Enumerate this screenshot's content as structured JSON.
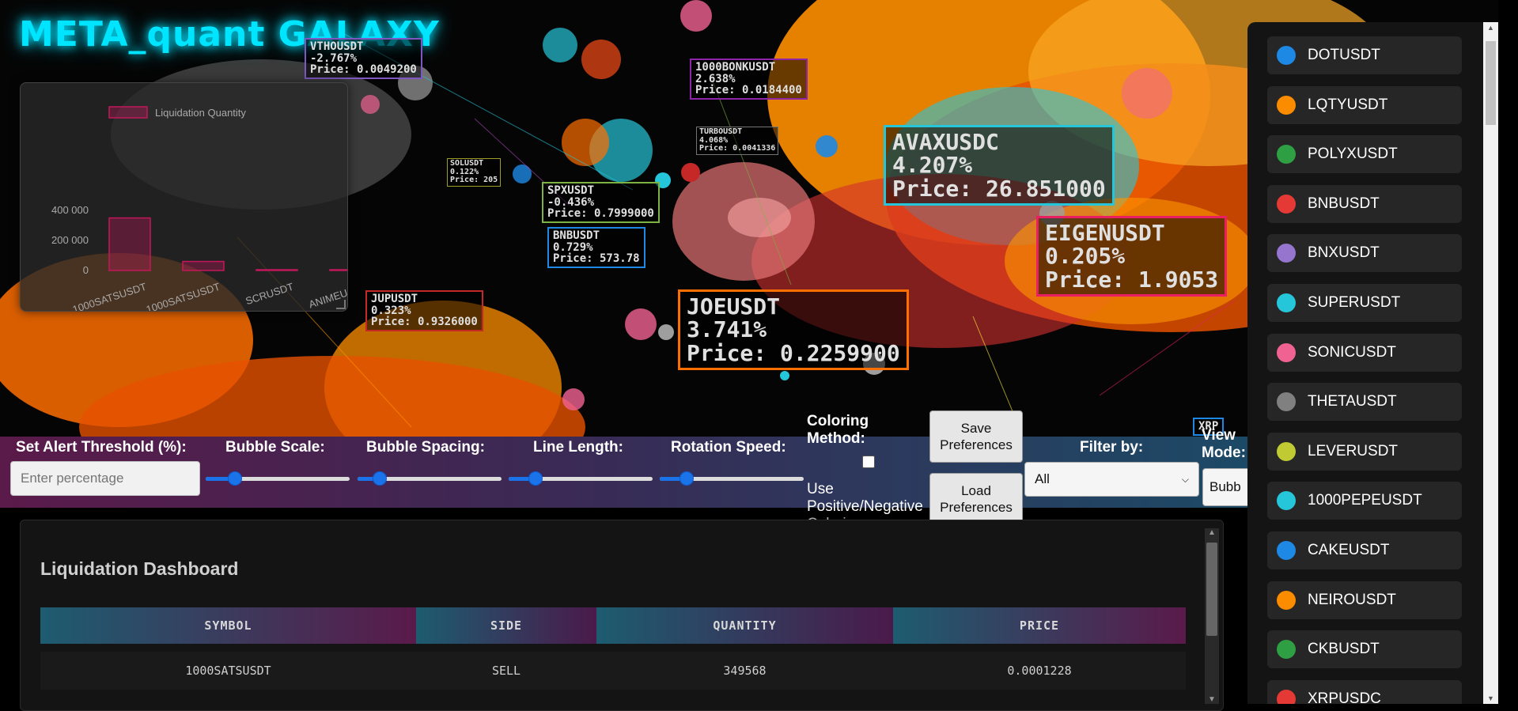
{
  "app": {
    "title": "META_quant GALAXY"
  },
  "colors": {
    "accent": "#00e5ff",
    "slider": "#1a73e8",
    "bar": "#c2185b"
  },
  "bubble_labels": [
    {
      "symbol": "AVAXUSDC",
      "pct": "4.207%",
      "price": "Price: 26.851000",
      "color": "#26c6da",
      "size": "big"
    },
    {
      "symbol": "EIGENUSDT",
      "pct": "0.205%",
      "price": "Price: 1.9053",
      "color": "#e91e63",
      "size": "big"
    },
    {
      "symbol": "JOEUSDT",
      "pct": "3.741%",
      "price": "Price: 0.2259900",
      "color": "#ff6f00",
      "size": "big"
    },
    {
      "symbol": "JUPUSDT",
      "pct": "0.323%",
      "price": "Price: 0.9326000",
      "color": "#c62828",
      "size": "mid"
    },
    {
      "symbol": "SPXUSDT",
      "pct": "-0.436%",
      "price": "Price: 0.7999000",
      "color": "#7cb342",
      "size": "mid"
    },
    {
      "symbol": "BNBUSDT",
      "pct": "0.729%",
      "price": "Price: 573.78",
      "color": "#1e88e5",
      "size": "mid"
    },
    {
      "symbol": "VTHOUSDT",
      "pct": "-2.767%",
      "price": "Price: 0.0049200",
      "color": "#7e57c2",
      "size": "mid"
    },
    {
      "symbol": "1000BONKUSDT",
      "pct": "2.638%",
      "price": "Price: 0.0184400",
      "color": "#8e24aa",
      "size": "mid"
    },
    {
      "symbol": "TURBOUSDT",
      "pct": "4.068%",
      "price": "Price: 0.0041336",
      "color": "#757575",
      "size": "small"
    },
    {
      "symbol": "SOLUSDT",
      "pct": "0.122%",
      "price": "Price: 205",
      "color": "#9e9d24",
      "size": "small"
    },
    {
      "symbol": "XRP",
      "pct": "",
      "price": "",
      "color": "#1e88e5",
      "size": "mid"
    }
  ],
  "mini_chart": {
    "chart_data": {
      "type": "bar",
      "categories": [
        "1000SATSUSDT",
        "1000SATSUSDT",
        "SCRUSDT",
        "ANIMEUSDT"
      ],
      "series": [
        {
          "name": "Liquidation Quantity",
          "values": [
            349568,
            60000,
            1500,
            1500
          ]
        }
      ],
      "ylim": [
        0,
        400000
      ],
      "yticks": [
        "400 000",
        "200 000",
        "0"
      ],
      "legend": "top"
    }
  },
  "controls": {
    "alert_label": "Set Alert Threshold (%):",
    "alert_placeholder": "Enter percentage",
    "bubble_scale_label": "Bubble Scale:",
    "bubble_scale_value": 0.2,
    "bubble_spacing_label": "Bubble Spacing:",
    "bubble_spacing_value": 0.15,
    "line_length_label": "Line Length:",
    "line_length_value": 0.18,
    "rotation_speed_label": "Rotation Speed:",
    "rotation_speed_value": 0.18,
    "coloring_label_1": "Coloring",
    "coloring_label_2": "Method:",
    "coloring_option_1": "Use",
    "coloring_option_2": "Positive/Negative",
    "coloring_option_3": "Coloring",
    "save_label_1": "Save",
    "save_label_2": "Preferences",
    "load_label_1": "Load",
    "load_label_2": "Preferences",
    "filter_label": "Filter by:",
    "filter_value": "All",
    "view_label_1": "View",
    "view_label_2": "Mode:",
    "view_value": "Bubb"
  },
  "dashboard": {
    "title": "Liquidation Dashboard",
    "columns": [
      "SYMBOL",
      "SIDE",
      "QUANTITY",
      "PRICE"
    ],
    "rows": [
      {
        "symbol": "1000SATSUSDT",
        "side": "SELL",
        "quantity": "349568",
        "price": "0.0001228"
      }
    ]
  },
  "symbols": [
    {
      "name": "DOTUSDT",
      "color": "#1e88e5"
    },
    {
      "name": "LQTYUSDT",
      "color": "#fb8c00"
    },
    {
      "name": "POLYXUSDT",
      "color": "#2ea043"
    },
    {
      "name": "BNBUSDT",
      "color": "#e53935"
    },
    {
      "name": "BNXUSDT",
      "color": "#9575cd"
    },
    {
      "name": "SUPERUSDT",
      "color": "#26c6da"
    },
    {
      "name": "SONICUSDT",
      "color": "#f06292"
    },
    {
      "name": "THETAUSDT",
      "color": "#808080"
    },
    {
      "name": "LEVERUSDT",
      "color": "#c0ca33"
    },
    {
      "name": "1000PEPEUSDT",
      "color": "#26c6da"
    },
    {
      "name": "CAKEUSDT",
      "color": "#1e88e5"
    },
    {
      "name": "NEIROUSDT",
      "color": "#fb8c00"
    },
    {
      "name": "CKBUSDT",
      "color": "#2ea043"
    },
    {
      "name": "XRPUSDC",
      "color": "#e53935"
    }
  ]
}
